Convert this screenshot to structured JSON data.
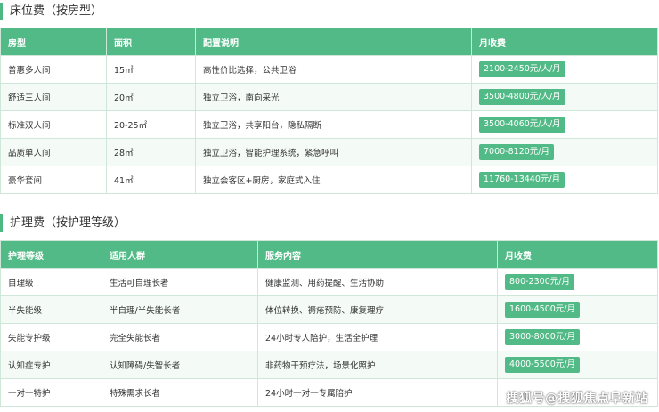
{
  "bed_section": {
    "title": "床位费（按房型）",
    "headers": [
      "房型",
      "面积",
      "配置说明",
      "月收费"
    ],
    "rows": [
      {
        "type": "普惠多人间",
        "area": "15㎡",
        "config": "高性价比选择，公共卫浴",
        "price": "2100-2450元/人/月"
      },
      {
        "type": "舒适三人间",
        "area": "20㎡",
        "config": "独立卫浴，南向采光",
        "price": "3500-4800元/人/月"
      },
      {
        "type": "标准双人间",
        "area": "20-25㎡",
        "config": "独立卫浴，共享阳台，隐私隔断",
        "price": "3500-4060元/人/月"
      },
      {
        "type": "品质单人间",
        "area": "28㎡",
        "config": "独立卫浴，智能护理系统，紧急呼叫",
        "price": "7000-8120元/月"
      },
      {
        "type": "豪华套间",
        "area": "41㎡",
        "config": "独立会客区+厨房，家庭式入住",
        "price": "11760-13440元/月"
      }
    ]
  },
  "care_section": {
    "title": "护理费（按护理等级）",
    "headers": [
      "护理等级",
      "适用人群",
      "服务内容",
      "月收费"
    ],
    "rows": [
      {
        "level": "自理级",
        "group": "生活可自理长者",
        "service": "健康监测、用药提醒、生活协助",
        "price": "800-2300元/月"
      },
      {
        "level": "半失能级",
        "group": "半自理/半失能长者",
        "service": "体位转换、褥疮预防、康复理疗",
        "price": "1600-4500元/月"
      },
      {
        "level": "失能专护级",
        "group": "完全失能长者",
        "service": "24小时专人陪护，生活全护理",
        "price": "3000-8000元/月"
      },
      {
        "level": "认知症专护",
        "group": "认知障碍/失智长者",
        "service": "非药物干预疗法，场景化照护",
        "price": "4000-5500元/月"
      },
      {
        "level": "一对一特护",
        "group": "特殊需求长者",
        "service": "24小时一对一专属陪护",
        "price": ""
      }
    ]
  },
  "watermark": "搜狐号@搜狐焦点阜新站",
  "colors": {
    "accent": "#52ba86",
    "border": "#cfe7d9",
    "row_alt": "#f4fbf7"
  }
}
